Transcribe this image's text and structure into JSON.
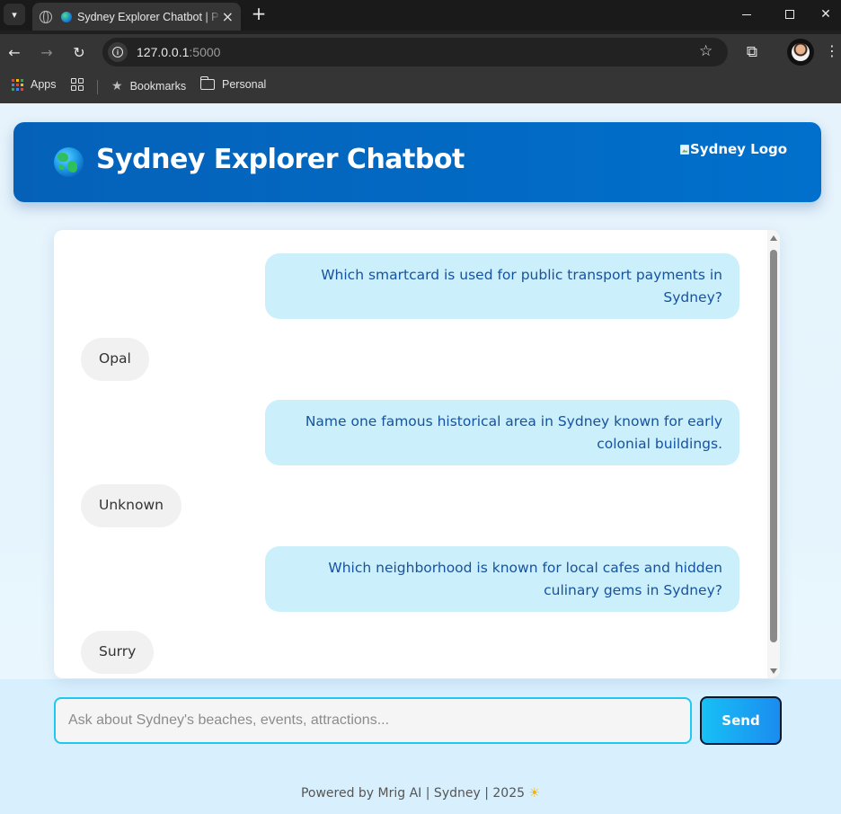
{
  "browser": {
    "tab_title": "Sydney Explorer Chatbot | P",
    "url_host": "127.0.0.1",
    "url_port": ":5000",
    "bookmarks_bar": {
      "apps": "Apps",
      "bookmarks": "Bookmarks",
      "personal": "Personal"
    }
  },
  "header": {
    "title": "Sydney Explorer Chatbot",
    "logo_alt": "Sydney Logo"
  },
  "messages": [
    {
      "role": "user",
      "text": "Which smartcard is used for public transport payments in Sydney?"
    },
    {
      "role": "bot",
      "text": "Opal"
    },
    {
      "role": "user",
      "text": "Name one famous historical area in Sydney known for early colonial buildings."
    },
    {
      "role": "bot",
      "text": "Unknown"
    },
    {
      "role": "user",
      "text": "Which neighborhood is known for local cafes and hidden culinary gems in Sydney?"
    },
    {
      "role": "bot",
      "text": "Surry"
    }
  ],
  "input": {
    "placeholder": "Ask about Sydney's beaches, events, attractions...",
    "value": ""
  },
  "send_label": "Send",
  "footer": {
    "text": "Powered by Mrig AI | Sydney | 2025",
    "emoji": "☀"
  },
  "colors": {
    "header_bg": "#0568c2",
    "user_bubble": "#cceffc",
    "bot_bubble": "#f1f1f1",
    "accent": "#1ec8f0"
  }
}
